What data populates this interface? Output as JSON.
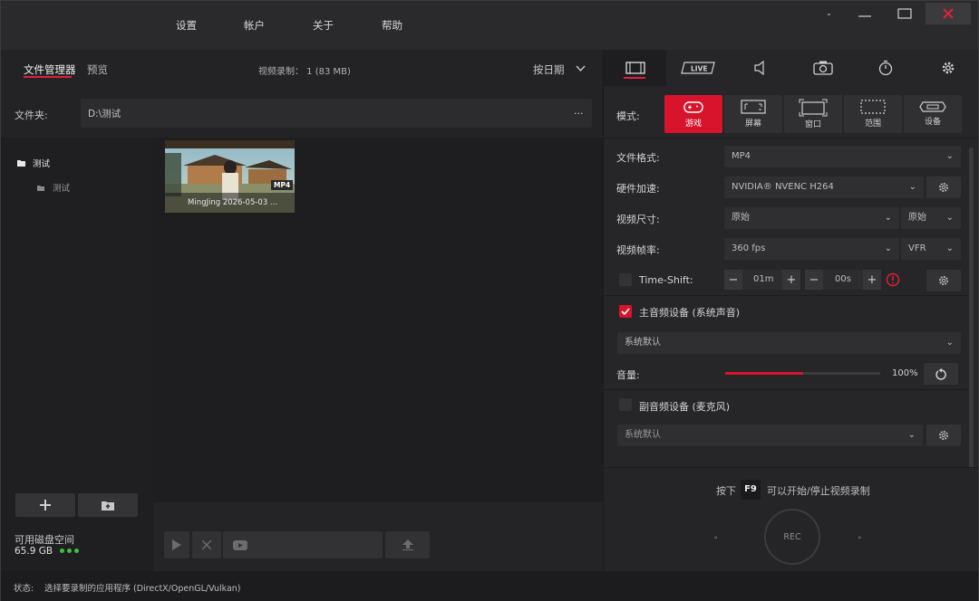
{
  "menu": {
    "settings": "设置",
    "account": "帐户",
    "about": "关于",
    "help": "帮助"
  },
  "window_controls": {
    "close_icon": "close-icon",
    "accent": "#e0203a"
  },
  "left": {
    "tab_file_manager": "文件管理器",
    "tab_preview": "预览",
    "recording_info": "视频录制： 1 (83 MB)",
    "sort_label": "按日期",
    "folder_label": "文件夹:",
    "folder_path": "D:\\测试",
    "folder_more": "...",
    "tree": [
      {
        "label": "测试"
      },
      {
        "label": "测试"
      }
    ],
    "thumbnail": {
      "caption": "MingJing 2026-05-03 ...",
      "badge": "MP4"
    },
    "disk_label": "可用磁盘空间",
    "disk_value": "65.9 GB"
  },
  "right": {
    "mode_label": "模式:",
    "modes": [
      {
        "label": "游戏",
        "icon": "gamepad-icon"
      },
      {
        "label": "屏幕",
        "icon": "screen-icon"
      },
      {
        "label": "窗口",
        "icon": "window-icon"
      },
      {
        "label": "范围",
        "icon": "area-icon"
      },
      {
        "label": "设备",
        "icon": "device-icon"
      }
    ],
    "file_format_label": "文件格式:",
    "file_format": "MP4",
    "hw_accel_label": "硬件加速:",
    "hw_accel": "NVIDIA® NVENC H264",
    "video_size_label": "视频尺寸:",
    "video_size": "原始",
    "video_size2": "原始",
    "fps_label": "视频帧率:",
    "fps": "360 fps",
    "fps_mode": "VFR",
    "timeshift_label": "Time-Shift:",
    "timeshift_min": "01m",
    "timeshift_sec": "00s",
    "main_audio_label": "主音频设备 (系统声音)",
    "main_audio_device": "系统默认",
    "volume_label": "音量:",
    "volume_value": "100%",
    "volume_fraction": 0.5,
    "sub_audio_label": "副音频设备 (麦克风)",
    "sub_audio_device": "系统默认",
    "hotkey_prefix": "按下",
    "hotkey": "F9",
    "hotkey_suffix": "可以开始/停止视频录制",
    "rec_label": "REC"
  },
  "status": {
    "label": "状态:",
    "text": "选择要录制的应用程序 (DirectX/OpenGL/Vulkan)"
  }
}
